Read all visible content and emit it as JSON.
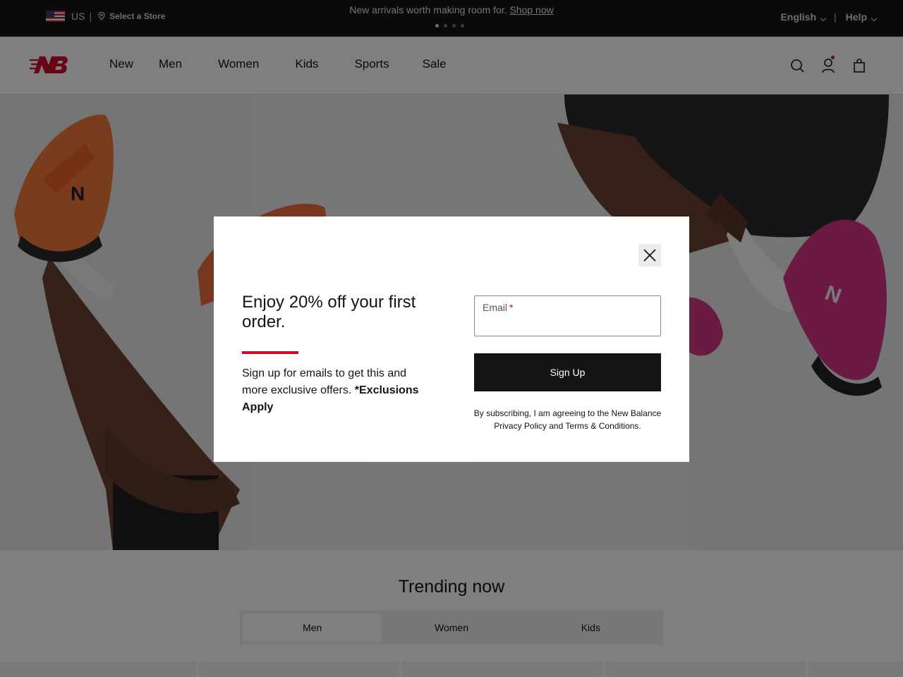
{
  "topbar": {
    "country": "US",
    "store_label": "Select a Store",
    "promo_text": "New arrivals worth making room for.",
    "promo_link": "Shop now",
    "language": "English",
    "help": "Help",
    "carousel_dots": 4,
    "carousel_active": 1
  },
  "nav": {
    "items": [
      {
        "label": "New"
      },
      {
        "label": "Men"
      },
      {
        "label": "Women"
      },
      {
        "label": "Kids"
      },
      {
        "label": "Sports"
      },
      {
        "label": "Sale"
      }
    ],
    "icons": [
      "search-icon",
      "account-icon",
      "bag-icon"
    ]
  },
  "trending": {
    "title": "Trending now",
    "tabs": [
      {
        "label": "Men",
        "active": true
      },
      {
        "label": "Women",
        "active": false
      },
      {
        "label": "Kids",
        "active": false
      }
    ]
  },
  "modal": {
    "title": "Enjoy 20% off your first order.",
    "body_text": "Sign up for emails to get this and more exclusive offers.",
    "body_bold": "*Exclusions Apply",
    "email_label": "Email",
    "email_required": "*",
    "email_value": "",
    "signup_label": "Sign Up",
    "terms": "By subscribing, I am agreeing to the New Balance Privacy Policy and Terms & Conditions."
  },
  "colors": {
    "brand_red": "#cf0a2c",
    "dark": "#151415",
    "topbar_bg": "#151415"
  }
}
